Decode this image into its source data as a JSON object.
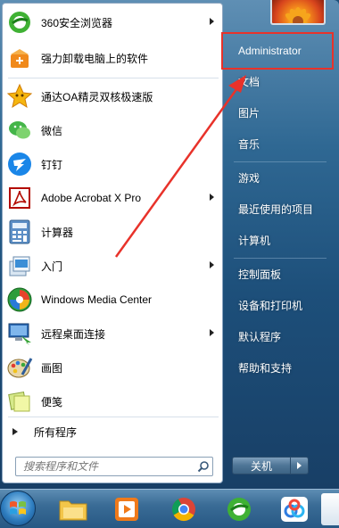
{
  "programs": [
    {
      "label": "360安全浏览器",
      "icon": "360-browser-icon",
      "has_submenu": true
    },
    {
      "label": "强力卸载电脑上的软件",
      "icon": "uninstall-box-icon",
      "has_submenu": false
    },
    {
      "label": "通达OA精灵双核极速版",
      "icon": "star-icon",
      "has_submenu": false
    },
    {
      "label": "微信",
      "icon": "wechat-icon",
      "has_submenu": false
    },
    {
      "label": "钉钉",
      "icon": "dingtalk-icon",
      "has_submenu": false
    },
    {
      "label": "Adobe Acrobat X Pro",
      "icon": "acrobat-icon",
      "has_submenu": true
    },
    {
      "label": "计算器",
      "icon": "calculator-icon",
      "has_submenu": false
    },
    {
      "label": "入门",
      "icon": "getting-started-icon",
      "has_submenu": true
    },
    {
      "label": "Windows Media Center",
      "icon": "media-center-icon",
      "has_submenu": false
    },
    {
      "label": "远程桌面连接",
      "icon": "remote-desktop-icon",
      "has_submenu": true
    },
    {
      "label": "画图",
      "icon": "paint-icon",
      "has_submenu": false
    },
    {
      "label": "便笺",
      "icon": "sticky-notes-icon",
      "has_submenu": false
    }
  ],
  "all_programs_label": "所有程序",
  "search": {
    "placeholder": "搜索程序和文件"
  },
  "user": {
    "name": "Administrator"
  },
  "right_menu": {
    "documents": "文档",
    "pictures": "图片",
    "music": "音乐",
    "games": "游戏",
    "recent_items": "最近使用的项目",
    "computer": "计算机",
    "control_panel": "控制面板",
    "devices_printers": "设备和打印机",
    "default_programs": "默认程序",
    "help_support": "帮助和支持"
  },
  "shutdown_label": "关机",
  "taskbar": [
    "start-orb-icon",
    "file-explorer-icon",
    "media-player-icon",
    "chrome-icon",
    "360-browser-icon",
    "baidu-netdisk-icon"
  ],
  "colors": {
    "highlight": "#e8322a",
    "menu_blue": "#1d4f7a"
  }
}
